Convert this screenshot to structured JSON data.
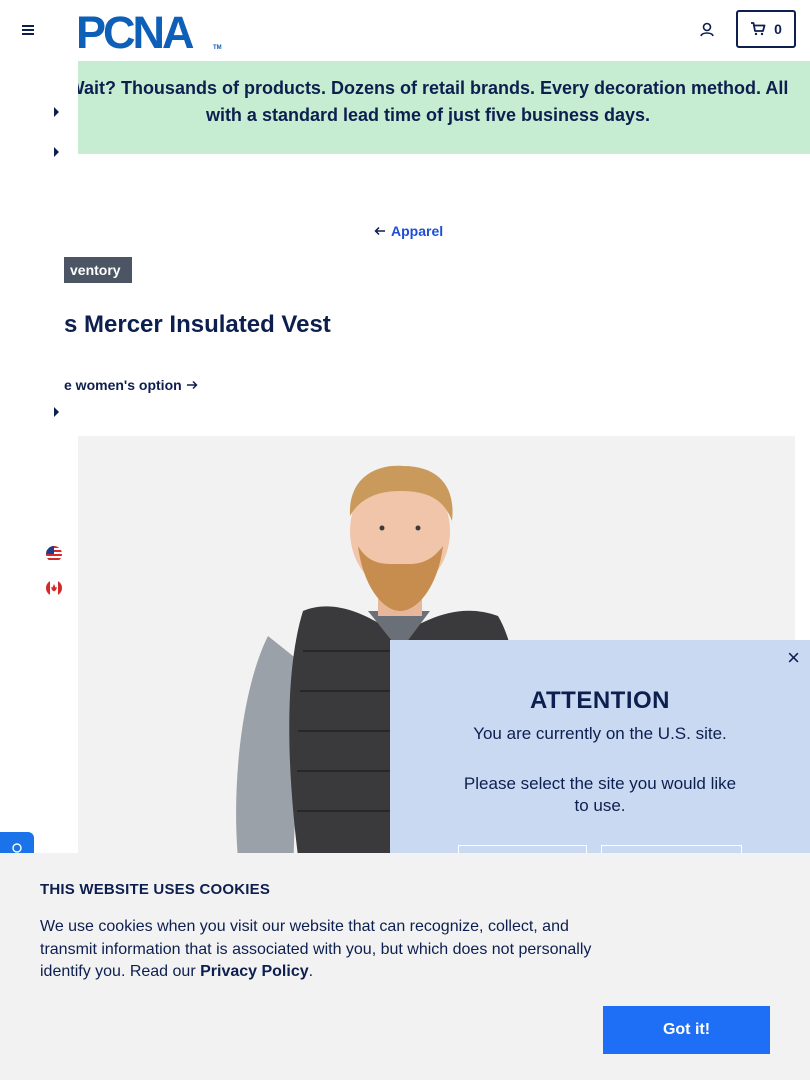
{
  "header": {
    "logo_text": "PCNA",
    "logo_tm": "TM",
    "cart_count": "0",
    "brand_color": "#0d1f4f"
  },
  "promo": {
    "text": "Wait? Thousands of products. Dozens of retail brands. Every decoration method. All with a standard lead time of just five business days.",
    "background": "#c6edd2"
  },
  "breadcrumb": {
    "back_label": "Apparel"
  },
  "product": {
    "badge": "ventory",
    "title": "s Mercer Insulated Vest",
    "womens_link": "e women's option"
  },
  "attention": {
    "close": "×",
    "title": "ATTENTION",
    "line1": "You are currently on the U.S. site.",
    "line2": "Please select the site you would like to use.",
    "background": "#c9d9f2"
  },
  "cookies": {
    "title": "THIS WEBSITE USES COOKIES",
    "text_before": "We use cookies when you visit our website that can recognize, collect, and transmit information that is associated with you, but which does not personally identify you. Read our ",
    "link": "Privacy Policy",
    "text_after": ".",
    "button": "Got it!",
    "button_color": "#1e6ff5"
  },
  "icons": [
    "menu-icon",
    "account-icon",
    "cart-icon",
    "arrow-left-icon",
    "arrow-right-icon",
    "us-flag-icon",
    "canada-flag-icon",
    "close-icon",
    "feedback-icon"
  ]
}
